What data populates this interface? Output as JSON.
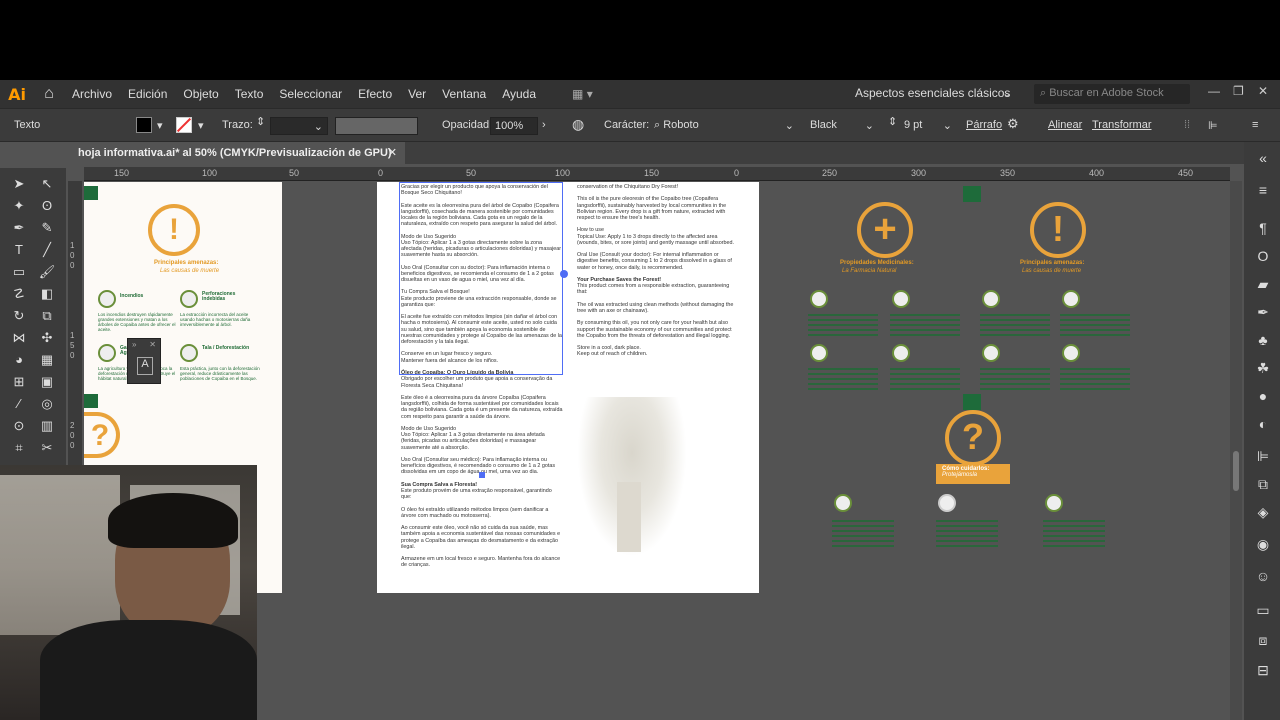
{
  "app": {
    "logo": "Ai"
  },
  "menu": [
    "Archivo",
    "Edición",
    "Objeto",
    "Texto",
    "Seleccionar",
    "Efecto",
    "Ver",
    "Ventana",
    "Ayuda"
  ],
  "workspace": "Aspectos esenciales clásicos",
  "stock_search_placeholder": "Buscar en Adobe Stock",
  "control": {
    "selection_type": "Texto",
    "stroke_label": "Trazo:",
    "opacity_label": "Opacidad:",
    "opacity_value": "100%",
    "character_label": "Carácter:",
    "font_family": "Roboto",
    "font_style": "Black",
    "font_size": "9 pt",
    "paragraph_label": "Párrafo",
    "align_label": "Alinear",
    "transform_label": "Transformar"
  },
  "document_tab": "hoja informativa.ai* al 50% (CMYK/Previsualización de GPU)",
  "ruler_h": [
    "150",
    "100",
    "50",
    "0",
    "50",
    "100",
    "150",
    "0",
    "250",
    "300",
    "350",
    "400",
    "450"
  ],
  "ruler_v": [
    "1",
    "0",
    "0",
    "1",
    "5",
    "0",
    "2",
    "0",
    "0"
  ],
  "left_artboard": {
    "threats_title": "Principales amenazas:",
    "threats_subtitle": "Las causas de muerte",
    "items": [
      {
        "title": "Incendios",
        "text": "Los incendios destruyen rápidamente grandes extensiones y matan a los árboles de Copaiba antes de ofrecer el aceite."
      },
      {
        "title": "Perforaciones indebidas",
        "text": "La extracción incorrecta del aceite usando hachas o motosierras daña irreversiblemente al árbol."
      },
      {
        "title": "Ganadería / Agricultura",
        "text": "La agricultura y ganadería provoca la deforestación masiva. Esto destruye el hábitat natural de Copaiba."
      },
      {
        "title": "Tala / Deforestación",
        "text": "Esta práctica, junto con la deforestación general, reduce drásticamente las poblaciones de Copaiba en el Bosque."
      }
    ]
  },
  "center_left_text": [
    "Gracias por elegir un producto que apoya la conservación del Bosque Seco Chiquitano!",
    "Este aceite es la oleorresina pura del árbol de Copaibo (Copaifera langsdorffii), cosechada de manera sostenible por comunidades locales de la región boliviana. Cada gota es un regalo de la naturaleza, extraído con respeto para asegurar la salud del árbol.",
    "Modo de Uso Sugerido",
    "Uso Tópico: Aplicar 1 a 3 gotas directamente sobre la zona afectada (heridas, picaduras o articulaciones doloridas) y masajear suavemente hasta su absorción.",
    "Uso Oral (Consultar con su doctor): Para inflamación interna o beneficios digestivos, se recomienda el consumo de 1 a 2 gotas disueltas en un vaso de agua o miel, una vez al día.",
    "Tu Compra Salva el Bosque!",
    "Este producto proviene de una extracción responsable, donde se garantiza que:",
    "El aceite fue extraído con métodos limpios (sin dañar el árbol con hacha o motosierra). Al consumir este aceite, usted no solo cuida su salud, sino que también apoya la economía sostenible de nuestras comunidades y protege al Copaibo de las amenazas de la deforestación y la tala ilegal.",
    "Conserve en un lugar fresco y seguro.",
    "Mantener fuera del alcance de los niños.",
    "Óleo de Copaíba: O Ouro Líquido da Bolívia",
    "Obrigado por escolher um produto que apoia a conservação da Floresta Seca Chiquitana!",
    "Este óleo é a oleorresina pura da árvore Copaíba (Copaifera langsdorffii), colhida de forma sustentável por comunidades locais da região boliviana. Cada gota é um presente da natureza, extraída com respeito para garantir a saúde da árvore.",
    "Modo de Uso Sugerido",
    "Uso Tópico: Aplicar 1 a 3 gotas diretamente na área afetada (feridas, picadas ou articulações doloridas) e massagear suavemente até a absorção.",
    "Uso Oral (Consultar seu médico): Para inflamação interna ou benefícios digestivos, é recomendado o consumo de 1 a 2 gotas dissolvidas em um copo de água ou mel, uma vez ao dia.",
    "Sua Compra Salva a Floresta!",
    "Este produto provém de uma extração responsável, garantindo que:",
    "O óleo foi extraído utilizando métodos limpos (sem danificar a árvore com machado ou motosserra).",
    "Ao consumir este óleo, você não só cuida da sua saúde, mas também apoia a economia sustentável das nossas comunidades e protege a Copaíba das ameaças do desmatamento e da extração ilegal.",
    "Armazene em um local fresco e seguro. Mantenha fora do alcance de crianças."
  ],
  "center_right_text": [
    "conservation of the Chiquitano Dry Forest!",
    "This oil is the pure oleoresin of the Copaibo tree (Copaifera langsdorffii), sustainably harvested by local communities in the Bolivian region. Every drop is a gift from nature, extracted with respect to ensure the tree's health.",
    "How to use",
    "Topical Use: Apply 1 to 3 drops directly to the affected area (wounds, bites, or sore joints) and gently massage until absorbed.",
    "Oral Use (Consult your doctor): For internal inflammation or digestive benefits, consuming 1 to 2 drops dissolved in a glass of water or honey, once daily, is recommended.",
    "Your Purchase Saves the Forest!",
    "This product comes from a responsible extraction, guaranteeing that:",
    "The oil was extracted using clean methods (without damaging the tree with an axe or chainsaw).",
    "By consuming this oil, you not only care for your health but also support the sustainable economy of our communities and protect the Copaibo from the threats of deforestation and illegal logging.",
    "Store in a cool, dark place.",
    "Keep out of reach of children."
  ],
  "right_area": {
    "medicinal_title": "Propiedades Medicinales:",
    "medicinal_subtitle": "La Farmacia Natural",
    "threats_title": "Principales amenazas:",
    "threats_subtitle": "Las causas de muerte",
    "care_title": "Cómo cuidarlos:",
    "care_subtitle": "Protejámosla"
  },
  "colors": {
    "accent_orange": "#e9a33b",
    "brand_green": "#1e6b3a",
    "ui_dark": "#323232",
    "ui_bg": "#535353"
  }
}
